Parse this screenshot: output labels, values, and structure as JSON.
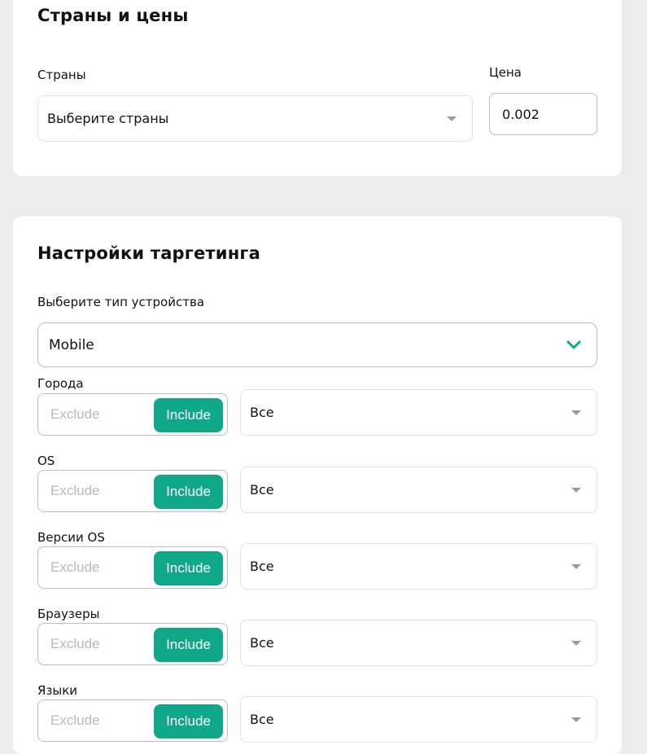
{
  "countries_section": {
    "title": "Страны и цены",
    "countries_label": "Страны",
    "countries_placeholder": "Выберите страны",
    "price_label": "Цена",
    "price_value": "0.002"
  },
  "targeting_section": {
    "title": "Настройки таргетинга",
    "device_label": "Выберите тип устройства",
    "device_value": "Mobile",
    "filters": [
      {
        "label": "Города",
        "exclude": "Exclude",
        "include": "Include",
        "value": "Все"
      },
      {
        "label": "OS",
        "exclude": "Exclude",
        "include": "Include",
        "value": "Все"
      },
      {
        "label": "Версии OS",
        "exclude": "Exclude",
        "include": "Include",
        "value": "Все"
      },
      {
        "label": "Браузеры",
        "exclude": "Exclude",
        "include": "Include",
        "value": "Все"
      },
      {
        "label": "Языки",
        "exclude": "Exclude",
        "include": "Include",
        "value": "Все"
      }
    ]
  },
  "colors": {
    "accent": "#0fa98a",
    "background": "#ececec",
    "card": "#ffffff"
  },
  "icons": {
    "dropdown": "caret-down-icon",
    "device_dropdown": "chevron-down-icon"
  }
}
